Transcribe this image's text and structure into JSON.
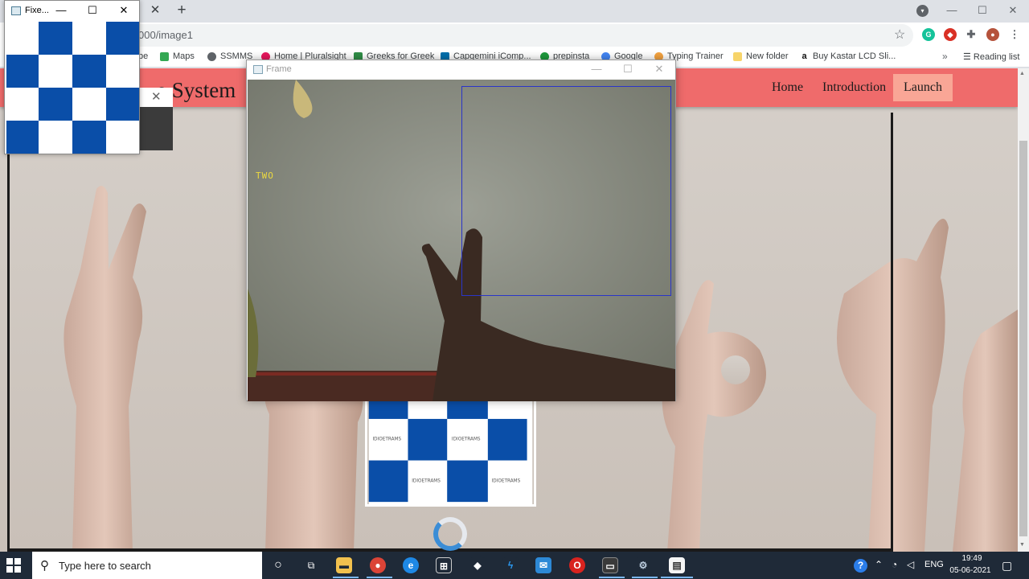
{
  "browser": {
    "url": "000/image1",
    "bookmarks": [
      {
        "label": "be",
        "icon": "bookmark-icon",
        "color": "#d93025"
      },
      {
        "label": "Maps",
        "icon": "maps-icon",
        "color": "#34a853"
      },
      {
        "label": "SSMMS",
        "icon": "globe-icon",
        "color": "#5f6368"
      },
      {
        "label": "Home | Pluralsight",
        "icon": "pluralsight-icon",
        "color": "#e8175d"
      },
      {
        "label": "Greeks for Greek",
        "icon": "gfg-icon",
        "color": "#2f8d46"
      },
      {
        "label": "Capgemini iComp...",
        "icon": "capgemini-icon",
        "color": "#0070ad"
      },
      {
        "label": "prepinsta",
        "icon": "prepinsta-icon",
        "color": "#1e9a3c"
      },
      {
        "label": "Google",
        "icon": "google-icon",
        "color": "#4285f4"
      },
      {
        "label": "Typing Trainer",
        "icon": "typing-icon",
        "color": "#f4a340"
      },
      {
        "label": "New folder",
        "icon": "folder-icon",
        "color": "#f7d46a"
      },
      {
        "label": "Buy Kastar LCD Sli...",
        "icon": "amazon-icon",
        "color": "#111111"
      }
    ],
    "reading_list": "Reading list",
    "more": "»"
  },
  "site": {
    "title": "e System",
    "nav": [
      {
        "label": "Home"
      },
      {
        "label": "Introduction"
      },
      {
        "label": "Launch"
      }
    ],
    "accent": "#ef6b6b",
    "active_nav": "#f9a696"
  },
  "fixed_window": {
    "title": "Fixe...",
    "controls": [
      "—",
      "☐",
      "✕"
    ]
  },
  "frame_window": {
    "title": "Frame",
    "gesture": "TWO",
    "controls": [
      "—",
      "☐",
      "✕"
    ]
  },
  "taskbar": {
    "search_placeholder": "Type here to search",
    "lang": "ENG",
    "time": "19:49",
    "date": "05-06-2021"
  }
}
